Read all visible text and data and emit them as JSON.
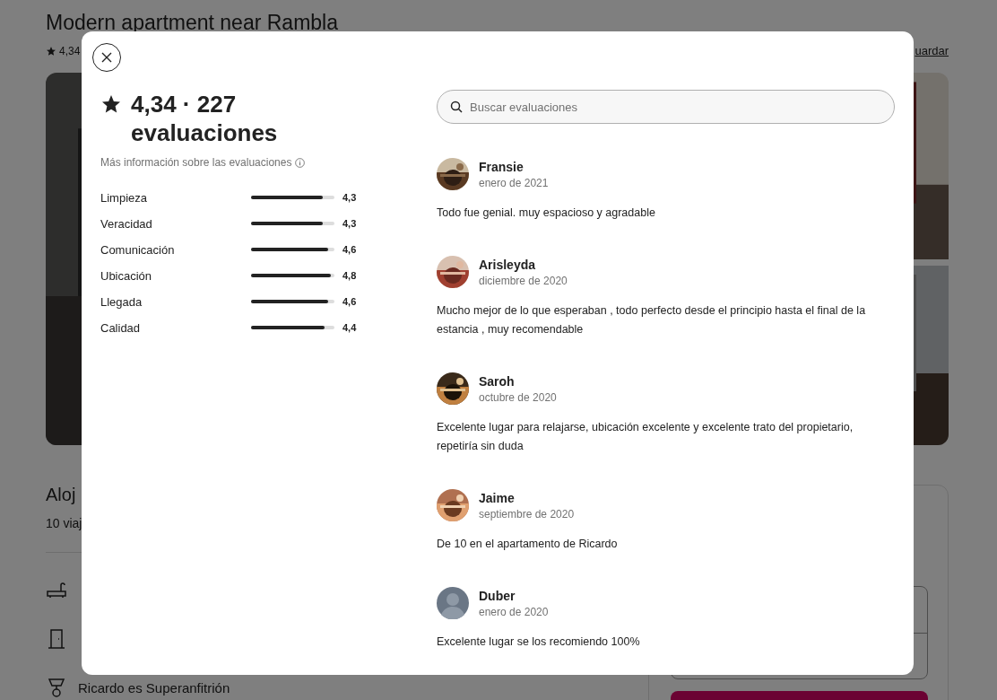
{
  "page": {
    "title": "Modern apartment near Rambla",
    "rating": "4,34",
    "save_link": "uardar",
    "section_title": "Aloj",
    "section_subtitle": "10 viaj",
    "host_line": "Ricardo es Superanfitrión"
  },
  "modal": {
    "rating_title": "4,34 · 227",
    "rating_subtitle": "evaluaciones",
    "info_link": "Más información sobre las evaluaciones",
    "categories": [
      {
        "label": "Limpieza",
        "level": 0.86,
        "value": "4,3"
      },
      {
        "label": "Veracidad",
        "level": 0.86,
        "value": "4,3"
      },
      {
        "label": "Comunicación",
        "level": 0.92,
        "value": "4,6"
      },
      {
        "label": "Ubicación",
        "level": 0.96,
        "value": "4,8"
      },
      {
        "label": "Llegada",
        "level": 0.92,
        "value": "4,6"
      },
      {
        "label": "Calidad",
        "level": 0.88,
        "value": "4,4"
      }
    ],
    "search": {
      "placeholder": "Buscar evaluaciones"
    },
    "reviews": [
      {
        "name": "Fransie",
        "date": "enero de 2021",
        "text": "Todo fue genial. muy espacioso y agradable",
        "kind": "picture"
      },
      {
        "name": "Arisleyda",
        "date": "diciembre de 2020",
        "text": "Mucho mejor de lo que esperaban , todo perfecto desde el principio hasta el final de la estancia , muy recomendable",
        "kind": "picture"
      },
      {
        "name": "Saroh",
        "date": "octubre de 2020",
        "text": "Excelente lugar para relajarse, ubicación excelente y excelente trato del propietario, repetiría sin duda",
        "kind": "picture"
      },
      {
        "name": "Jaime",
        "date": "septiembre de 2020",
        "text": "De 10 en el apartamento de Ricardo",
        "kind": "picture"
      },
      {
        "name": "Duber",
        "date": "enero de 2020",
        "text": "Excelente lugar se los recomiendo 100%",
        "kind": "default"
      }
    ]
  }
}
